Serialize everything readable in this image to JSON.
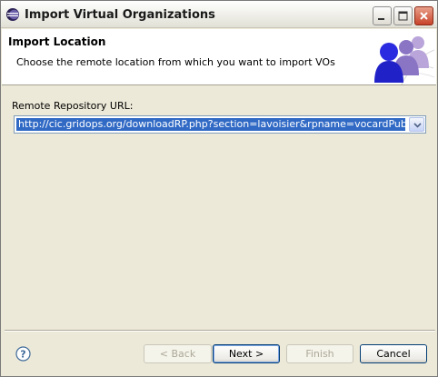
{
  "window": {
    "title": "Import Virtual Organizations"
  },
  "banner": {
    "title": "Import Location",
    "description": "Choose the remote location from which you want to import VOs"
  },
  "form": {
    "url_label": "Remote Repository URL:",
    "url_value": "http://cic.gridops.org/downloadRP.php?section=lavoisier&rpname=vocardPublic&vo=all"
  },
  "buttons": {
    "back": "< Back",
    "next": "Next >",
    "finish": "Finish",
    "cancel": "Cancel"
  },
  "colors": {
    "selection": "#316ac5",
    "dialog_bg": "#ece9d8",
    "close_button": "#c8432a"
  },
  "icons": {
    "app": "eclipse-icon",
    "help": "help-icon",
    "banner": "users-group-icon"
  }
}
